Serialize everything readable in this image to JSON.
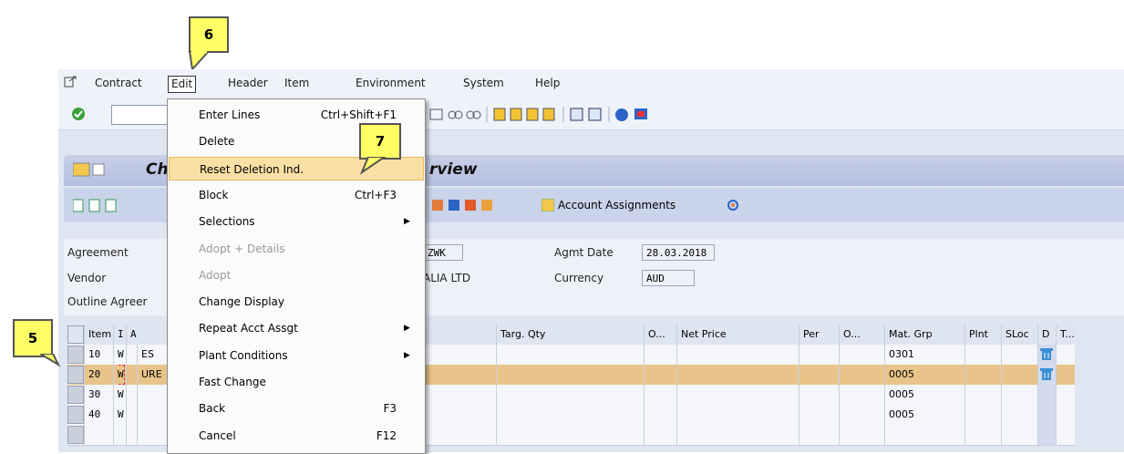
{
  "callouts": {
    "six": "6",
    "seven": "7",
    "five": "5"
  },
  "menubar": {
    "items": [
      "Contract",
      "Edit",
      "Header",
      "Item",
      "Environment",
      "System",
      "Help"
    ]
  },
  "title": "Ch",
  "title_right": "rview",
  "app_toolbar": {
    "account_assignments": "Account Assignments"
  },
  "form": {
    "agreement_label": "Agreement",
    "vendor_label": "Vendor",
    "outline_label": "Outline Agreer",
    "agreement_value": "ZWK",
    "vendor_value": "ALIA LTD",
    "agmt_date_label": "Agmt Date",
    "agmt_date_value": "28.03.2018",
    "currency_label": "Currency",
    "currency_value": "AUD"
  },
  "table": {
    "headers": {
      "item": "Item",
      "i": "I",
      "a": "A",
      "targ_qty": "Targ. Qty",
      "o1": "O...",
      "net_price": "Net Price",
      "per": "Per",
      "o2": "O...",
      "mat_grp": "Mat. Grp",
      "plnt": "Plnt",
      "sloc": "SLoc",
      "d": "D",
      "t": "T..."
    },
    "rows": [
      {
        "item": "10",
        "i": "W",
        "text": "ES",
        "mat_grp": "0301",
        "deleted": true
      },
      {
        "item": "20",
        "i": "W",
        "text": "URE",
        "mat_grp": "0005",
        "deleted": true
      },
      {
        "item": "30",
        "i": "W",
        "text": "",
        "mat_grp": "0005",
        "deleted": false
      },
      {
        "item": "40",
        "i": "W",
        "text": "",
        "mat_grp": "0005",
        "deleted": false
      },
      {
        "item": "",
        "i": "",
        "text": "",
        "mat_grp": "",
        "deleted": false
      }
    ]
  },
  "dropdown": {
    "items": [
      {
        "label": "Enter Lines",
        "shortcut": "Ctrl+Shift+F1",
        "submenu": false,
        "disabled": false
      },
      {
        "label": "Delete",
        "shortcut": "Sh",
        "submenu": false,
        "disabled": false
      },
      {
        "label": "Reset Deletion Ind.",
        "shortcut": "",
        "submenu": false,
        "disabled": false,
        "highlighted": true
      },
      {
        "label": "Block",
        "shortcut": "Ctrl+F3",
        "submenu": false,
        "disabled": false
      },
      {
        "label": "Selections",
        "shortcut": "",
        "submenu": true,
        "disabled": false
      },
      {
        "label": "Adopt + Details",
        "shortcut": "",
        "submenu": false,
        "disabled": true
      },
      {
        "label": "Adopt",
        "shortcut": "",
        "submenu": false,
        "disabled": true
      },
      {
        "label": "Change Display",
        "shortcut": "",
        "submenu": false,
        "disabled": false
      },
      {
        "label": "Repeat Acct Assgt",
        "shortcut": "",
        "submenu": true,
        "disabled": false
      },
      {
        "label": "Plant Conditions",
        "shortcut": "",
        "submenu": true,
        "disabled": false
      },
      {
        "label": "Fast Change",
        "shortcut": "",
        "submenu": false,
        "disabled": false
      },
      {
        "label": "Back",
        "shortcut": "F3",
        "submenu": false,
        "disabled": false
      },
      {
        "label": "Cancel",
        "shortcut": "F12",
        "submenu": false,
        "disabled": false
      }
    ]
  },
  "colors": {
    "highlight_row": "#e8c48a",
    "menu_highlight": "#fbe0a6",
    "callout": "#ffff66",
    "titlebar": "#b9c2e0"
  }
}
